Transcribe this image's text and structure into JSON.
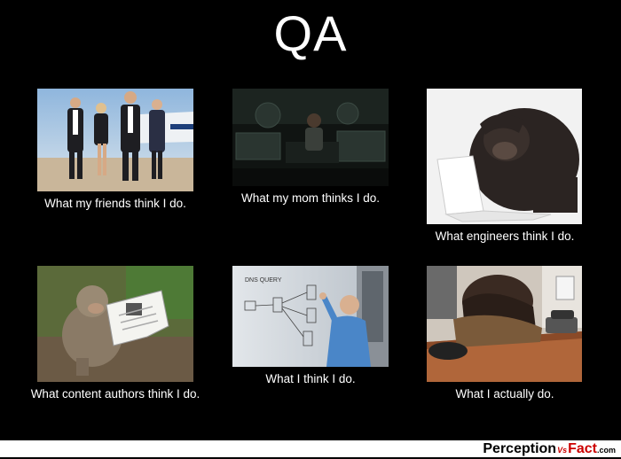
{
  "title": "QA",
  "panels": [
    {
      "caption": "What my friends think I do."
    },
    {
      "caption": "What my mom thinks I do."
    },
    {
      "caption": "What engineers think I do."
    },
    {
      "caption": "What content authors think I do."
    },
    {
      "caption": "What I think I do."
    },
    {
      "caption": "What I actually do."
    }
  ],
  "diagram_labels": {
    "query": "DNS QUERY"
  },
  "footer": {
    "brand_part1": "Perception",
    "brand_vs": "Vs",
    "brand_part2": "Fact",
    "brand_tld": ".com"
  }
}
